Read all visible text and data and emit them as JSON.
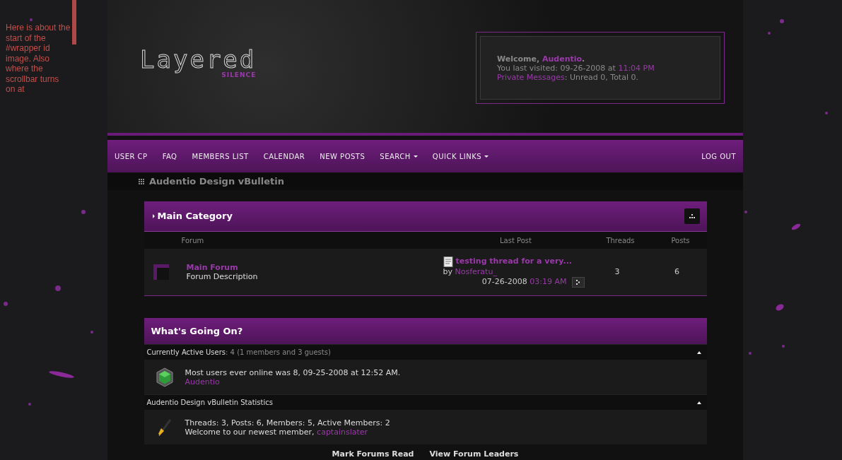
{
  "annotation": "Here is about the start of the #wrapper id image. Also where the scrollbar turns on at",
  "logo": {
    "title": "Layered",
    "subtitle": "SILENCE"
  },
  "welcome": {
    "greeting": "Welcome,",
    "username": "Audentio",
    "greeting_end": ".",
    "last_visited": "You last visited: 09-26-2008 at",
    "last_visited_time": "11:04 PM",
    "pm_link": "Private Messages",
    "pm_status": ": Unread 0, Total 0."
  },
  "nav": {
    "items": [
      {
        "label": "USER CP",
        "dropdown": false
      },
      {
        "label": "FAQ",
        "dropdown": false
      },
      {
        "label": "MEMBERS LIST",
        "dropdown": false
      },
      {
        "label": "CALENDAR",
        "dropdown": false
      },
      {
        "label": "NEW POSTS",
        "dropdown": false
      },
      {
        "label": "SEARCH",
        "dropdown": true
      },
      {
        "label": "QUICK LINKS",
        "dropdown": true
      }
    ],
    "logout": "LOG OUT"
  },
  "breadcrumb": "Audentio Design vBulletin",
  "category": {
    "title": "Main Category",
    "columns": [
      "Forum",
      "Last Post",
      "Threads",
      "Posts"
    ],
    "forums": [
      {
        "name": "Main Forum",
        "description": "Forum Description",
        "last_post_title": "testing thread for a very...",
        "by": "by",
        "last_post_user": "Nosferatu_",
        "last_post_date": "07-26-2008",
        "last_post_time": "03:19 AM",
        "threads": "3",
        "posts": "6"
      }
    ]
  },
  "whats_going_on": {
    "title": "What's Going On?",
    "sections": [
      {
        "kind": "online",
        "heading": "Currently Active Users",
        "heading_detail": ": 4 (1 members and 3 guests)",
        "lines": [
          {
            "text": "Most users ever online was 8, 09-25-2008 at 12:52 AM."
          },
          {
            "link": "Audentio"
          }
        ]
      },
      {
        "kind": "stats",
        "heading": "Audentio Design vBulletin Statistics",
        "lines": [
          {
            "text": "Threads: 3, Posts: 6, Members: 5, Active Members: 2"
          },
          {
            "text": "Welcome to our newest member, ",
            "link": "captainslater"
          }
        ]
      }
    ]
  },
  "footer_links": [
    "Mark Forums Read",
    "View Forum Leaders"
  ]
}
